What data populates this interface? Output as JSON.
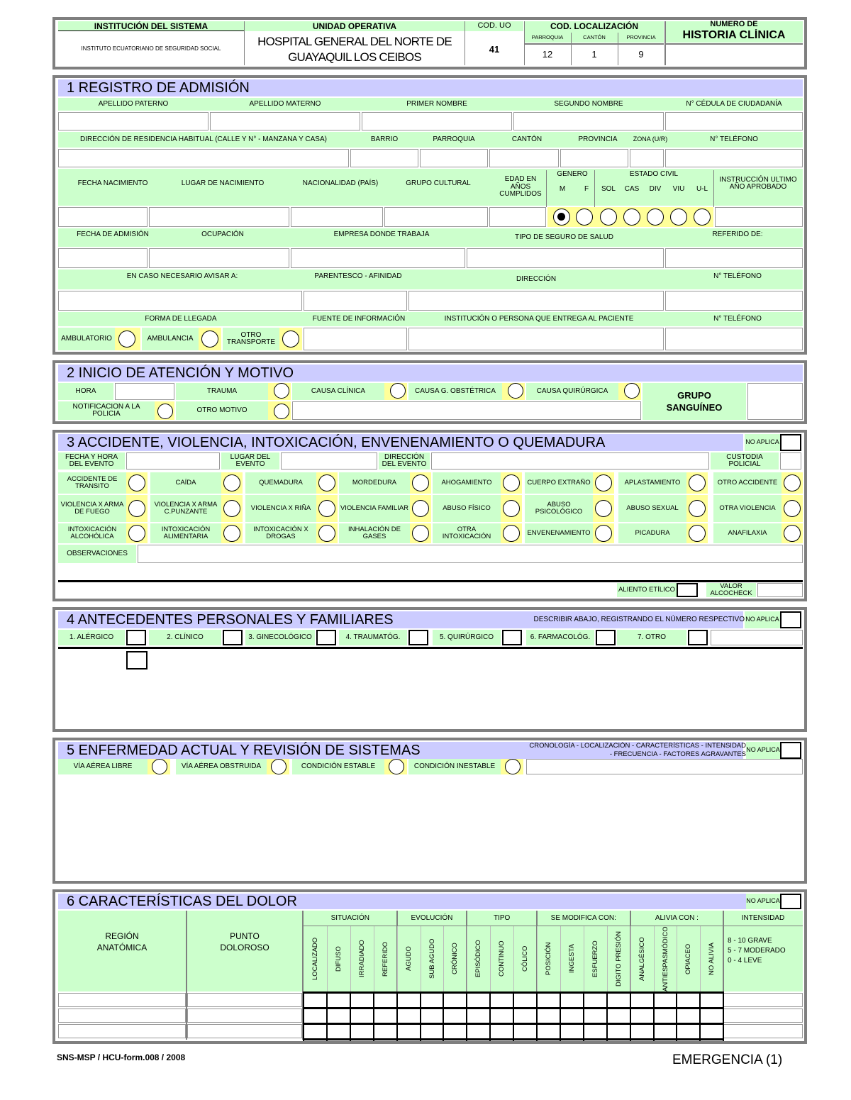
{
  "header": {
    "institucion_label": "INSTITUCIÓN DEL SISTEMA",
    "institucion_value": "INSTITUTO ECUATORIANO DE SEGURIDAD SOCIAL",
    "unidad_label": "UNIDAD OPERATIVA",
    "unidad_value_1": "HOSPITAL GENERAL DEL NORTE DE",
    "unidad_value_2": "GUAYAQUIL LOS CEIBOS",
    "cod_uo_label": "COD. UO",
    "cod_uo_value": "41",
    "cod_loc_label": "COD. LOCALIZACIÓN",
    "parroquia_label": "PARROQUIA",
    "canton_label": "CANTÓN",
    "provincia_label": "PROVINCIA",
    "parroquia_value": "12",
    "canton_value": "1",
    "provincia_value": "9",
    "hc_label_1": "NUMERO DE",
    "hc_label_2": "HISTORIA CLÍNICA"
  },
  "s1": {
    "title": "1   REGISTRO DE ADMISIÓN",
    "r1": [
      "APELLIDO PATERNO",
      "APELLIDO MATERNO",
      "PRIMER NOMBRE",
      "SEGUNDO NOMBRE",
      "N° CÉDULA DE CIUDADANÍA"
    ],
    "r2": [
      "DIRECCIÓN DE RESIDENCIA HABITUAL   (CALLE Y N° - MANZANA Y CASA)",
      "BARRIO",
      "PARROQUIA",
      "CANTÓN",
      "PROVINCIA",
      "ZONA (U/R)",
      "N° TELÉFONO"
    ],
    "r3": [
      "FECHA NACIMIENTO",
      "LUGAR DE NACIMIENTO",
      "NACIONALIDAD (PAÍS)",
      "GRUPO CULTURAL",
      "EDAD EN AÑOS CUMPLIDOS",
      "INSTRUCCIÓN ULTIMO AÑO APROBADO"
    ],
    "genero": "GENERO",
    "genero_m": "M",
    "genero_f": "F",
    "estado_civil": "ESTADO CIVIL",
    "ec": [
      "SOL",
      "CAS",
      "DIV",
      "VIU",
      "U-L"
    ],
    "r4": [
      "FECHA DE ADMISIÓN",
      "OCUPACIÓN",
      "EMPRESA DONDE TRABAJA",
      "TIPO DE SEGURO DE SALUD",
      "REFERIDO DE:"
    ],
    "r5": [
      "EN CASO NECESARIO AVISAR A:",
      "PARENTESCO - AFINIDAD",
      "DIRECCIÓN",
      "N° TELÉFONO"
    ],
    "r6": [
      "FORMA DE LLEGADA",
      "FUENTE DE INFORMACIÓN",
      "INSTITUCIÓN O PERSONA QUE ENTREGA AL PACIENTE",
      "N° TELÉFONO"
    ],
    "llegada": [
      "AMBULATORIO",
      "AMBULANCIA",
      "OTRO TRANSPORTE"
    ]
  },
  "s2": {
    "title": "2   INICIO DE ATENCIÓN Y MOTIVO",
    "hora": "HORA",
    "trauma": "TRAUMA",
    "causa_clinica": "CAUSA CLÍNICA",
    "causa_gobs": "CAUSA G. OBSTÉTRICA",
    "causa_quir": "CAUSA QUIRÚRGICA",
    "notif": "NOTIFICACION A LA POLICIA",
    "otro_motivo": "OTRO MOTIVO",
    "grupo_1": "GRUPO",
    "grupo_2": "SANGUÍNEO"
  },
  "s3": {
    "title": "3   ACCIDENTE, VIOLENCIA, INTOXICACIÓN, ENVENENAMIENTO O QUEMADURA",
    "no_aplica": "NO APLICA",
    "fecha_evento": "FECHA Y HORA DEL EVENTO",
    "lugar_evento": "LUGAR DEL EVENTO",
    "direccion_evento": "DIRECCIÓN DEL EVENTO",
    "custodia": "CUSTODIA POLICIAL",
    "row1": [
      "ACCIDENTE DE TRANSITO",
      "CAÍDA",
      "QUEMADURA",
      "MORDEDURA",
      "AHOGAMIENTO",
      "CUERPO EXTRAÑO",
      "APLASTAMIENTO",
      "OTRO ACCIDENTE"
    ],
    "row2": [
      "VIOLENCIA X ARMA DE FUEGO",
      "VIOLENCIA X ARMA C.PUNZANTE",
      "VIOLENCIA X RIÑA",
      "VIOLENCIA FAMILIAR",
      "ABUSO FÍSICO",
      "ABUSO PSICOLÓGICO",
      "ABUSO SEXUAL",
      "OTRA VIOLENCIA"
    ],
    "row3": [
      "INTOXICACIÓN ALCOHÓLICA",
      "INTOXICACIÓN ALIMENTARIA",
      "INTOXICACIÓN X DROGAS",
      "INHALACIÓN DE GASES",
      "OTRA INTOXICACIÓN",
      "ENVENENAMIENTO",
      "PICADURA",
      "ANAFILAXIA"
    ],
    "observaciones": "OBSERVACIONES",
    "aliento": "ALIENTO ETÍLICO",
    "alcocheck": "VALOR ALCOCHECK"
  },
  "s4": {
    "title": "4   ANTECEDENTES PERSONALES Y FAMILIARES",
    "hint": "DESCRIBIR ABAJO, REGISTRANDO EL NÚMERO RESPECTIVO",
    "no_aplica": "NO APLICA",
    "items": [
      "1. ALÉRGICO",
      "2. CLÍNICO",
      "3. GINECOLÓGICO",
      "4. TRAUMATÓG.",
      "5. QUIRÚRGICO",
      "6. FARMACOLÓG.",
      "7. OTRO"
    ]
  },
  "s5": {
    "title": "5   ENFERMEDAD ACTUAL Y REVISIÓN DE SISTEMAS",
    "hint_1": "CRONOLOGÍA - LOCALIZACIÓN - CARACTERÍSTICAS - INTENSIDAD",
    "hint_2": "- FRECUENCIA - FACTORES AGRAVANTES",
    "no_aplica": "NO APLICA",
    "items": [
      "VÍA AÉREA LIBRE",
      "VÍA AÉREA OBSTRUIDA",
      "CONDICIÓN ESTABLE",
      "CONDICIÓN INESTABLE"
    ]
  },
  "s6": {
    "title": "6   CARACTERÍSTICAS DEL DOLOR",
    "no_aplica": "NO APLICA",
    "region_1": "REGIÓN",
    "region_2": "ANATÓMICA",
    "punto_1": "PUNTO",
    "punto_2": "DOLOROSO",
    "groups": [
      "SITUACIÓN",
      "EVOLUCIÓN",
      "TIPO",
      "SE MODIFICA CON:",
      "ALIVIA CON :",
      "INTENSIDAD"
    ],
    "cols": [
      "LOCALIZADO",
      "DIFUSO",
      "IRRADIADO",
      "REFERIDO",
      "AGUDO",
      "SUB AGUDO",
      "CRÓNICO",
      "EPISÓDICO",
      "CONTINUO",
      "CÓLICO",
      "POSICIÓN",
      "INGESTA",
      "ESFUERZO",
      "DIGITO PRESIÓN",
      "ANALGÉSICO",
      "ANTIESPASMÓDICO",
      "OPIACEO",
      "NO ALIVIA"
    ],
    "int_1": "8 - 10   GRAVE",
    "int_2": "5 - 7     MODERADO",
    "int_3": "0 - 4     LEVE"
  },
  "footer": {
    "form": "SNS-MSP / HCU-form.008 / 2008",
    "emergencia": "EMERGENCIA  (1)"
  }
}
